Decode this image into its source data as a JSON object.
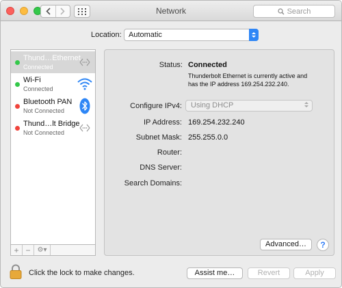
{
  "window": {
    "title": "Network"
  },
  "toolbar": {
    "back_icon": "chevron-left-icon",
    "forward_icon": "chevron-right-icon",
    "grid_icon": "grid-icon",
    "search_placeholder": "Search"
  },
  "location": {
    "label": "Location:",
    "value": "Automatic"
  },
  "services": [
    {
      "name": "Thund…Ethernet",
      "status": "Connected",
      "dot_color": "#34c84a",
      "icon": "ethernet-arrows-icon",
      "selected": true
    },
    {
      "name": "Wi-Fi",
      "status": "Connected",
      "dot_color": "#34c84a",
      "icon": "wifi-icon",
      "selected": false
    },
    {
      "name": "Bluetooth PAN",
      "status": "Not Connected",
      "dot_color": "#f0443c",
      "icon": "bluetooth-icon",
      "selected": false
    },
    {
      "name": "Thund…lt Bridge",
      "status": "Not Connected",
      "dot_color": "#f0443c",
      "icon": "ethernet-arrows-icon",
      "selected": false
    }
  ],
  "service_footer": {
    "add": "+",
    "remove": "−",
    "gear": "⚙▾"
  },
  "detail": {
    "status_label": "Status:",
    "status_value": "Connected",
    "status_desc": "Thunderbolt Ethernet is currently active and has the IP address 169.254.232.240.",
    "configure_label": "Configure IPv4:",
    "configure_value": "Using DHCP",
    "ip_label": "IP Address:",
    "ip_value": "169.254.232.240",
    "subnet_label": "Subnet Mask:",
    "subnet_value": "255.255.0.0",
    "router_label": "Router:",
    "dns_label": "DNS Server:",
    "search_domains_label": "Search Domains:",
    "advanced_label": "Advanced…",
    "help_label": "?"
  },
  "footer": {
    "lock_text": "Click the lock to make changes.",
    "assist_label": "Assist me…",
    "revert_label": "Revert",
    "apply_label": "Apply"
  },
  "colors": {
    "accent": "#2e86f6",
    "connected": "#34c84a",
    "disconnected": "#f0443c",
    "selected_row": "#d7d7d7"
  }
}
